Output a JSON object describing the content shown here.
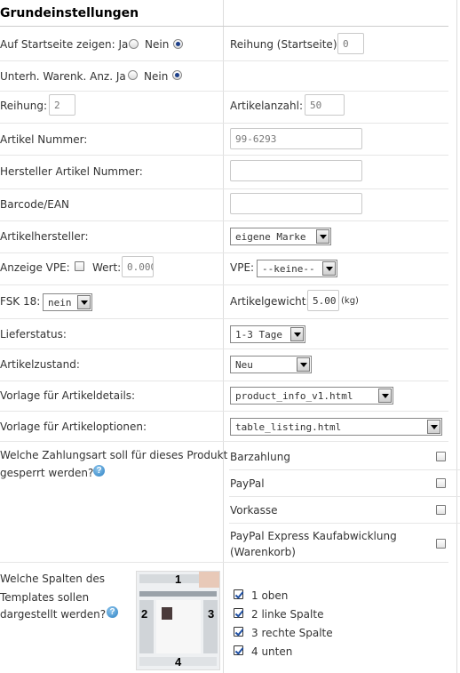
{
  "section_title": "Grundeinstellungen",
  "fields": {
    "startpage_label": "Auf Startseite zeigen: Ja",
    "startpage_no": "Nein",
    "startpage_value": "Nein",
    "order_start_label": "Reihung (Startseite):",
    "order_start_value": "0",
    "sub_label": "Unterh. Warenk. Anz. Ja",
    "sub_no": "Nein",
    "sub_value": "Nein",
    "order_label": "Reihung:",
    "order_value": "2",
    "qty_label": "Artikelanzahl:",
    "qty_value": "50",
    "artnr_label": "Artikel Nummer:",
    "artnr_value": "99-6293",
    "mfr_artnr_label": "Hersteller Artikel Nummer:",
    "mfr_artnr_value": "",
    "barcode_label": "Barcode/EAN",
    "barcode_value": "",
    "manufacturer_label": "Artikelhersteller:",
    "manufacturer_value": "eigene Marke",
    "vpe_show_label": "Anzeige VPE:",
    "vpe_show_checked": false,
    "vpe_value_label": "Wert:",
    "vpe_value": "0.000",
    "vpe_label": "VPE:",
    "vpe_select": "--keine--",
    "fsk_label": "FSK 18:",
    "fsk_value": "nein",
    "weight_label": "Artikelgewicht:",
    "weight_value": "5.00",
    "weight_unit": "(kg)",
    "delivery_label": "Lieferstatus:",
    "delivery_value": "1-3 Tage",
    "condition_label": "Artikelzustand:",
    "condition_value": "Neu",
    "template_details_label": "Vorlage für Artikeldetails:",
    "template_details_value": "product_info_v1.html",
    "template_options_label": "Vorlage für Artikeloptionen:",
    "template_options_value": "table_listing.html"
  },
  "payment": {
    "question_line1": "Welche Zahlungsart soll für dieses Produkt",
    "question_line2": "gesperrt werden?",
    "options": [
      {
        "label": "Barzahlung",
        "checked": false
      },
      {
        "label": "PayPal",
        "checked": false
      },
      {
        "label": "Vorkasse",
        "checked": false
      },
      {
        "label_line1": "PayPal Express Kaufabwicklung",
        "label_line2": "(Warenkorb)",
        "checked": false
      }
    ]
  },
  "columns": {
    "question_line1": "Welche Spalten des",
    "question_line2": "Templates sollen",
    "question_line3": "dargestellt werden?",
    "preview_numbers": [
      "1",
      "2",
      "3",
      "4"
    ],
    "options": [
      {
        "label": "1 oben",
        "checked": true
      },
      {
        "label": "2 linke Spalte",
        "checked": true
      },
      {
        "label": "3 rechte Spalte",
        "checked": true
      },
      {
        "label": "4 unten",
        "checked": true
      }
    ]
  },
  "colors": {
    "radio_dot": "#1c3f8a",
    "checkmark": "#1e4fa3",
    "help_icon": "#2a7fc2"
  }
}
